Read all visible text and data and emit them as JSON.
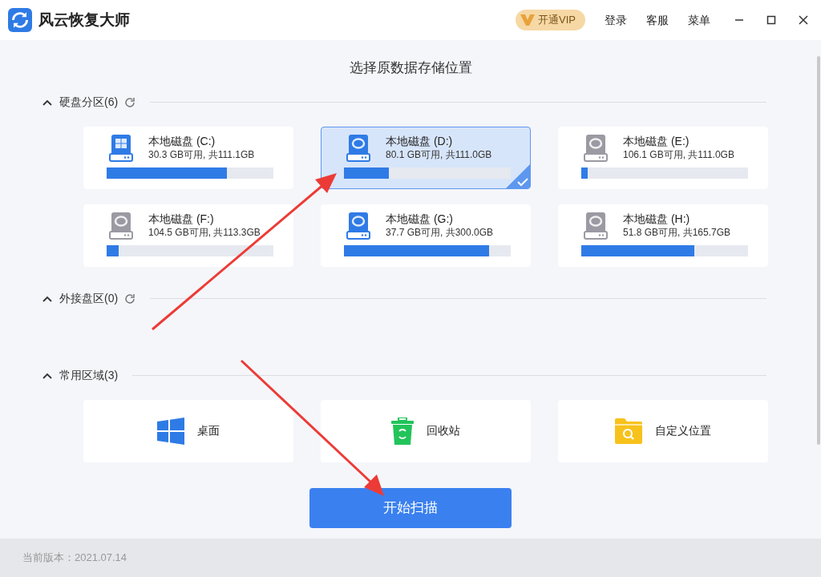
{
  "window": {
    "title": "风云恢复大师"
  },
  "title_bar": {
    "vip": "开通VIP",
    "links": [
      "登录",
      "客服",
      "菜单"
    ]
  },
  "heading": "选择原数据存储位置",
  "sections": [
    {
      "kind": "drives",
      "title": "硬盘分区(6)",
      "expanded": true,
      "refresh": true,
      "items": [
        {
          "name": "本地磁盘 (C:)",
          "usage": "30.3 GB可用, 共111.1GB",
          "level": 0.72,
          "kind": "system",
          "color": "#2f7be6",
          "selected": false
        },
        {
          "name": "本地磁盘 (D:)",
          "usage": "80.1 GB可用, 共111.0GB",
          "level": 0.27,
          "kind": "disk",
          "color": "#2f7be6",
          "selected": true
        },
        {
          "name": "本地磁盘 (E:)",
          "usage": "106.1 GB可用, 共111.0GB",
          "level": 0.04,
          "kind": "disk",
          "color": "#9b9aa3",
          "selected": false
        },
        {
          "name": "本地磁盘 (F:)",
          "usage": "104.5 GB可用, 共113.3GB",
          "level": 0.07,
          "kind": "disk",
          "color": "#9b9aa3",
          "selected": false
        },
        {
          "name": "本地磁盘 (G:)",
          "usage": "37.7 GB可用, 共300.0GB",
          "level": 0.87,
          "kind": "disk",
          "color": "#2f7be6",
          "selected": false
        },
        {
          "name": "本地磁盘 (H:)",
          "usage": "51.8 GB可用, 共165.7GB",
          "level": 0.68,
          "kind": "disk",
          "color": "#9b9aa3",
          "selected": false
        }
      ]
    },
    {
      "kind": "drives",
      "title": "外接盘区(0)",
      "expanded": true,
      "refresh": true
    },
    {
      "kind": "places",
      "title": "常用区域(3)",
      "expanded": true,
      "refresh": false,
      "items": [
        {
          "kind": "desktop",
          "label": "桌面"
        },
        {
          "kind": "recycle",
          "label": "回收站"
        },
        {
          "kind": "folder",
          "label": "自定义位置"
        }
      ]
    }
  ],
  "start_button": "开始扫描",
  "footer": "当前版本：2021.07.14"
}
